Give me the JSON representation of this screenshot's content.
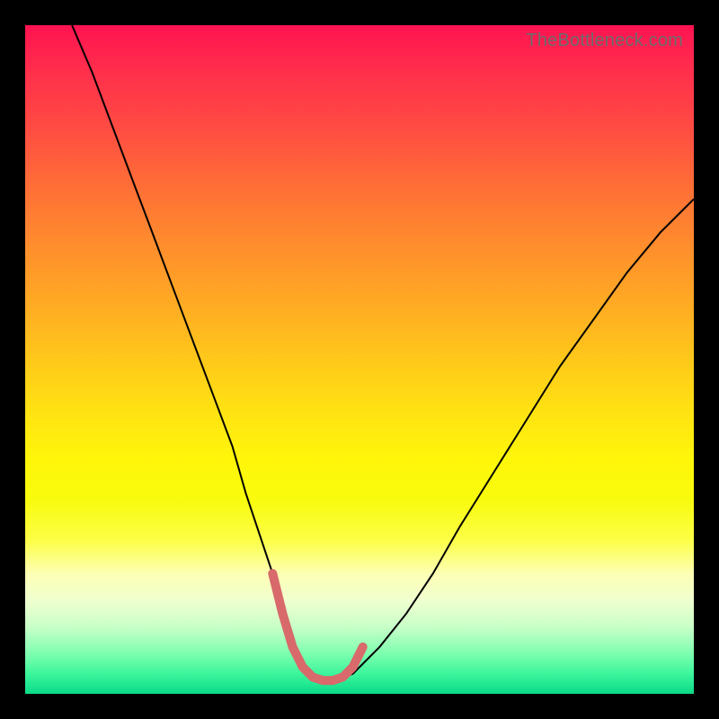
{
  "watermark": "TheBottleneck.com",
  "chart_data": {
    "type": "line",
    "title": "",
    "xlabel": "",
    "ylabel": "",
    "xlim": [
      0,
      100
    ],
    "ylim": [
      0,
      100
    ],
    "grid": false,
    "series": [
      {
        "name": "bottleneck-curve",
        "color": "#000000",
        "width": 2,
        "x": [
          7,
          10,
          13,
          16,
          19,
          22,
          25,
          28,
          31,
          33,
          35,
          37,
          39,
          40.5,
          42,
          44,
          46,
          49,
          53,
          57,
          61,
          65,
          70,
          75,
          80,
          85,
          90,
          95,
          100
        ],
        "y": [
          100,
          93,
          85,
          77,
          69,
          61,
          53,
          45,
          37,
          30,
          24,
          18,
          12,
          7,
          4,
          2,
          2,
          3,
          7,
          12,
          18,
          25,
          33,
          41,
          49,
          56,
          63,
          69,
          74
        ]
      },
      {
        "name": "highlight-bottom",
        "color": "#d86a6b",
        "width": 10,
        "linecap": "round",
        "x": [
          37,
          38.5,
          40,
          41.5,
          43,
          44.5,
          46,
          47.5,
          49,
          50.5
        ],
        "y": [
          18,
          12,
          7,
          4,
          2.5,
          2,
          2,
          2.5,
          4,
          7
        ]
      }
    ],
    "gradient_stops": [
      {
        "pct": 0,
        "color": "#ff1351"
      },
      {
        "pct": 15,
        "color": "#ff4a43"
      },
      {
        "pct": 32,
        "color": "#ff8a2e"
      },
      {
        "pct": 50,
        "color": "#ffc81a"
      },
      {
        "pct": 65,
        "color": "#fff60a"
      },
      {
        "pct": 82,
        "color": "#fdffb4"
      },
      {
        "pct": 94,
        "color": "#7dffaf"
      },
      {
        "pct": 100,
        "color": "#0bd988"
      }
    ]
  }
}
